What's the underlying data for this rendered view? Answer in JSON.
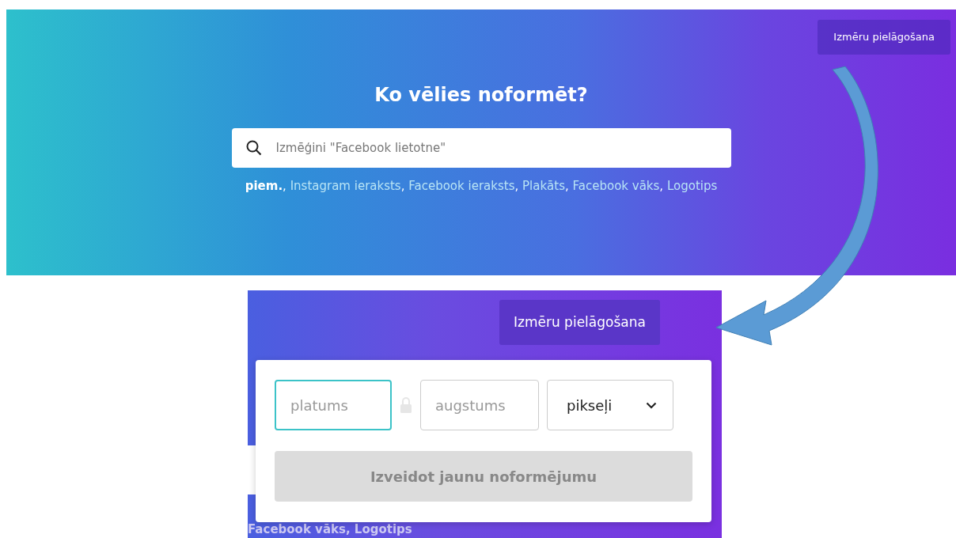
{
  "top_panel": {
    "resize_button": "Izmēru pielāgošana",
    "heading": "Ko vēlies noformēt?",
    "search": {
      "placeholder": "Izmēģini \"Facebook lietotne\""
    },
    "examples": {
      "label": "piem.",
      "separator": ", ",
      "items": [
        "Instagram ieraksts",
        "Facebook ieraksts",
        "Plakāts",
        "Facebook vāks",
        "Logotips"
      ]
    }
  },
  "bottom_panel": {
    "resize_button": "Izmēru pielāgošana",
    "background_text": "Facebook vāks, Logotips",
    "width_field": {
      "placeholder": "platums",
      "focused": true
    },
    "height_field": {
      "placeholder": "augstums",
      "focused": false
    },
    "unit_select": {
      "value": "pikseļi"
    },
    "create_button": {
      "label": "Izveidot jaunu noformējumu",
      "disabled": true
    }
  }
}
